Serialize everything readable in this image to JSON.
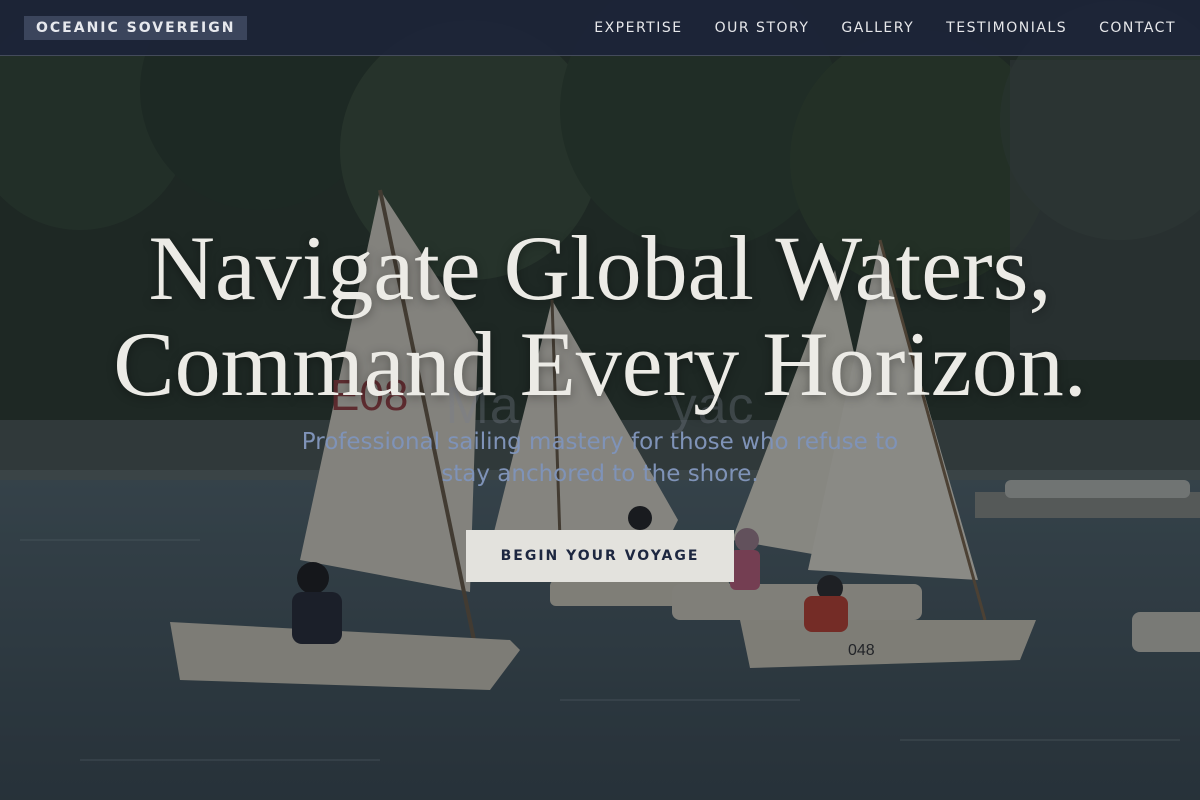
{
  "navbar": {
    "brand": "OCEANIC SOVEREIGN",
    "links": [
      "EXPERTISE",
      "OUR STORY",
      "GALLERY",
      "TESTIMONIALS",
      "CONTACT"
    ]
  },
  "hero": {
    "headline_line1": "Navigate Global Waters,",
    "headline_line2": "Command Every Horizon.",
    "ghost_text": "Ma",
    "ghost_text_2": "yac",
    "tagline": "Professional sailing mastery for those who refuse to stay anchored to the shore.",
    "cta_label": "BEGIN YOUR VOYAGE",
    "background_image": "sailing dinghies on water with trees",
    "sail_numbers": [
      "E08",
      "048"
    ]
  },
  "colors": {
    "navbar_bg": "#1c2438",
    "brand_bg": "#3b455c",
    "headline": "#ecebe6",
    "tagline": "#7f93b8",
    "cta_bg": "#e3e2dd",
    "cta_text": "#1d2740"
  }
}
